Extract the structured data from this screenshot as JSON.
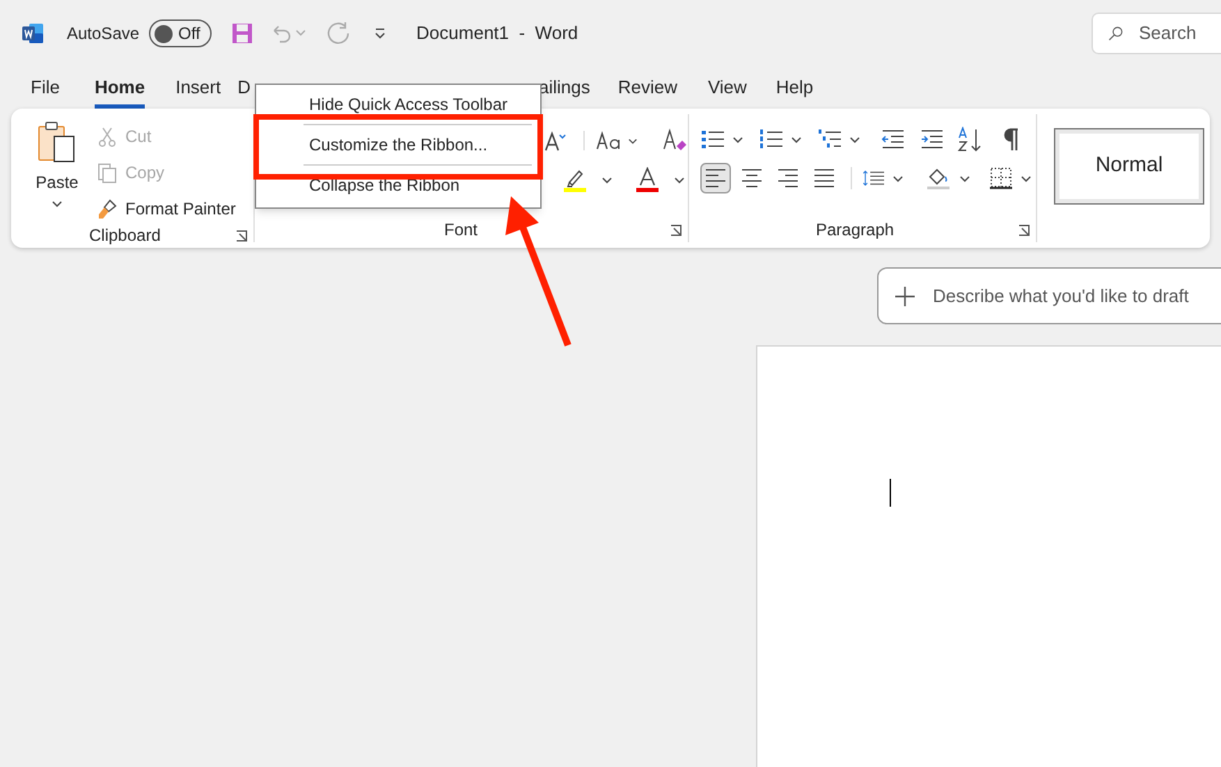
{
  "title_bar": {
    "autosave_label": "AutoSave",
    "autosave": {
      "label": "Off",
      "on": false
    },
    "document_title": "Document1  -  Word",
    "search": {
      "placeholder": "Search"
    }
  },
  "tabs": [
    {
      "label": "File",
      "selected": false
    },
    {
      "label": "Home",
      "selected": true
    },
    {
      "label": "Insert",
      "selected": false
    },
    {
      "label": "D",
      "selected": false
    },
    {
      "label": "ailings",
      "selected": false
    },
    {
      "label": "Review",
      "selected": false
    },
    {
      "label": "View",
      "selected": false
    },
    {
      "label": "Help",
      "selected": false
    }
  ],
  "ribbon": {
    "clipboard": {
      "paste_label": "Paste",
      "commands": [
        {
          "label": "Cut",
          "disabled": true
        },
        {
          "label": "Copy",
          "disabled": true
        },
        {
          "label": "Format Painter",
          "disabled": false
        }
      ],
      "group_label": "Clipboard"
    },
    "font": {
      "group_label": "Font"
    },
    "paragraph": {
      "group_label": "Paragraph",
      "alignment": [
        {
          "selected": true
        },
        {
          "selected": false
        },
        {
          "selected": false
        },
        {
          "selected": false
        }
      ]
    },
    "styles": {
      "style": "Normal"
    }
  },
  "context_menu": {
    "items": [
      "Hide Quick Access Toolbar",
      "Customize the Ribbon...",
      "Collapse the Ribbon"
    ]
  },
  "draft_prompt": {
    "placeholder": "Describe what you'd like to draft"
  }
}
